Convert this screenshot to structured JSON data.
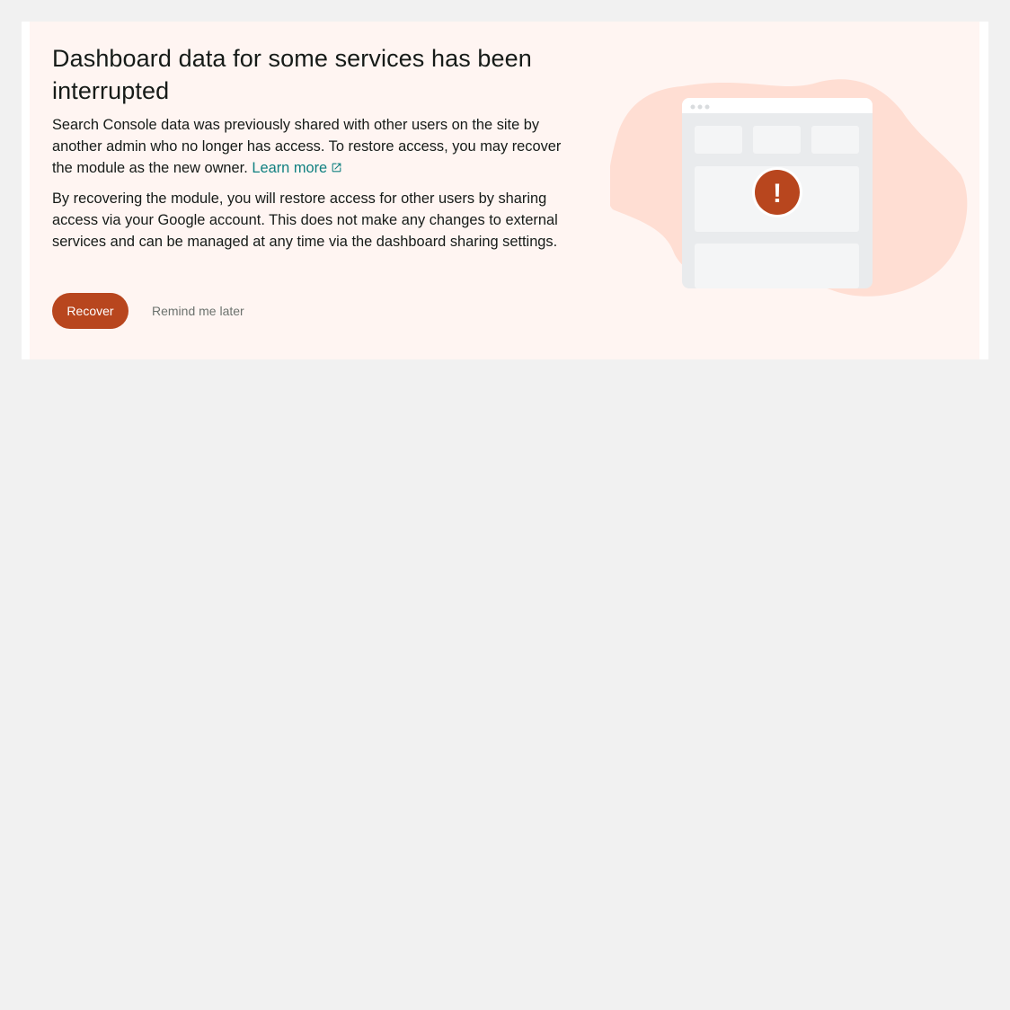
{
  "notice": {
    "title": "Dashboard data for some services has been interrupted",
    "description": "Search Console data was previously shared with other users on the site by another admin who no longer has access. To restore access, you may recover the module as the new owner.",
    "learn_more_label": "Learn more",
    "details": "By recovering the module, you will restore access for other users by sharing access via your Google account. This does not make any changes to external services and can be managed at any time via the dashboard sharing settings.",
    "recover_label": "Recover",
    "remind_label": "Remind me later"
  },
  "illustration": {
    "alert_symbol": "!",
    "icon": "dashboard-alert-illustration"
  },
  "colors": {
    "page_background": "#f1f1f1",
    "notice_background": "#fff5f2",
    "primary_button": "#b8461e",
    "link": "#108080",
    "blob": "#ffded3",
    "text": "#161b18"
  }
}
